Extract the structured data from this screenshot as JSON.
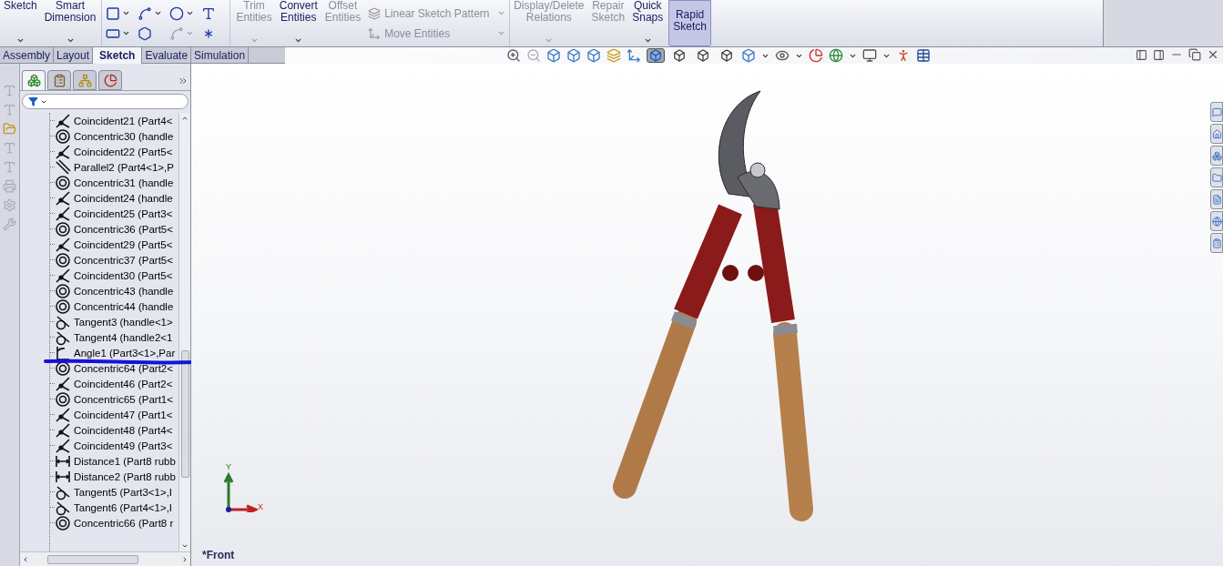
{
  "ribbon": {
    "commands": [
      {
        "label": "Sketch",
        "kind": "large",
        "disabled": false,
        "dropdown": true
      },
      {
        "label": "Smart\nDimension",
        "kind": "large",
        "disabled": false,
        "dropdown": true
      },
      {
        "kind": "tools"
      },
      {
        "label": "Trim\nEntities",
        "kind": "large",
        "disabled": true,
        "dropdown": true
      },
      {
        "label": "Convert\nEntities",
        "kind": "large",
        "disabled": false,
        "dropdown": true
      },
      {
        "label": "Offset\nEntities",
        "kind": "large",
        "disabled": true,
        "dropdown": false
      },
      {
        "label": "Linear Sketch Pattern",
        "kind": "small",
        "disabled": true,
        "dropdown": true
      },
      {
        "label": "Move Entities",
        "kind": "small",
        "disabled": true,
        "dropdown": true
      },
      {
        "label": "Display/Delete\nRelations",
        "kind": "large",
        "disabled": true,
        "dropdown": true
      },
      {
        "label": "Repair\nSketch",
        "kind": "large",
        "disabled": true,
        "dropdown": false
      },
      {
        "label": "Quick\nSnaps",
        "kind": "large",
        "disabled": false,
        "dropdown": true
      }
    ],
    "rapid_sketch": {
      "label": "Rapid\nSketch",
      "on": true
    }
  },
  "tabs": [
    {
      "label": "Assembly",
      "selected": false
    },
    {
      "label": "Layout",
      "selected": false
    },
    {
      "label": "Sketch",
      "selected": true
    },
    {
      "label": "Evaluate",
      "selected": false
    },
    {
      "label": "Simulation",
      "selected": false
    }
  ],
  "display_modes": [
    {
      "selected": true
    },
    {
      "selected": false
    },
    {
      "selected": false
    },
    {
      "selected": false
    }
  ],
  "manager_tabs": [
    {
      "selected": true
    },
    {
      "selected": false
    },
    {
      "selected": false
    },
    {
      "selected": false
    }
  ],
  "tree": {
    "items": [
      {
        "label": "Coincident21 (Part4<",
        "kind": "coincident"
      },
      {
        "label": "Concentric30 (handle",
        "kind": "concentric"
      },
      {
        "label": "Coincident22 (Part5<",
        "kind": "coincident"
      },
      {
        "label": "Parallel2 (Part4<1>,P",
        "kind": "parallel"
      },
      {
        "label": "Concentric31 (handle",
        "kind": "concentric"
      },
      {
        "label": "Coincident24 (handle",
        "kind": "coincident"
      },
      {
        "label": "Coincident25 (Part3<",
        "kind": "coincident"
      },
      {
        "label": "Concentric36 (Part5<",
        "kind": "concentric"
      },
      {
        "label": "Coincident29 (Part5<",
        "kind": "coincident"
      },
      {
        "label": "Concentric37 (Part5<",
        "kind": "concentric"
      },
      {
        "label": "Coincident30 (Part5<",
        "kind": "coincident"
      },
      {
        "label": "Concentric43 (handle",
        "kind": "concentric"
      },
      {
        "label": "Concentric44 (handle",
        "kind": "concentric"
      },
      {
        "label": "Tangent3 (handle<1>",
        "kind": "tangent"
      },
      {
        "label": "Tangent4 (handle2<1",
        "kind": "tangent"
      },
      {
        "label": "Angle1 (Part3<1>,Par",
        "kind": "angle"
      },
      {
        "label": "Concentric64 (Part2<",
        "kind": "concentric"
      },
      {
        "label": "Coincident46 (Part2<",
        "kind": "coincident"
      },
      {
        "label": "Concentric65 (Part1<",
        "kind": "concentric"
      },
      {
        "label": "Coincident47 (Part1<",
        "kind": "coincident"
      },
      {
        "label": "Coincident48 (Part4<",
        "kind": "coincident"
      },
      {
        "label": "Coincident49 (Part3<",
        "kind": "coincident"
      },
      {
        "label": "Distance1 (Part8 rubb",
        "kind": "distance"
      },
      {
        "label": "Distance2 (Part8 rubb",
        "kind": "distance"
      },
      {
        "label": "Tangent5 (Part3<1>,I",
        "kind": "tangent"
      },
      {
        "label": "Tangent6 (Part4<1>,I",
        "kind": "tangent"
      },
      {
        "label": "Concentric66 (Part8 r",
        "kind": "concentric"
      }
    ]
  },
  "viewport": {
    "axis_y": "Y",
    "axis_x": "X",
    "view_name": "*Front"
  }
}
